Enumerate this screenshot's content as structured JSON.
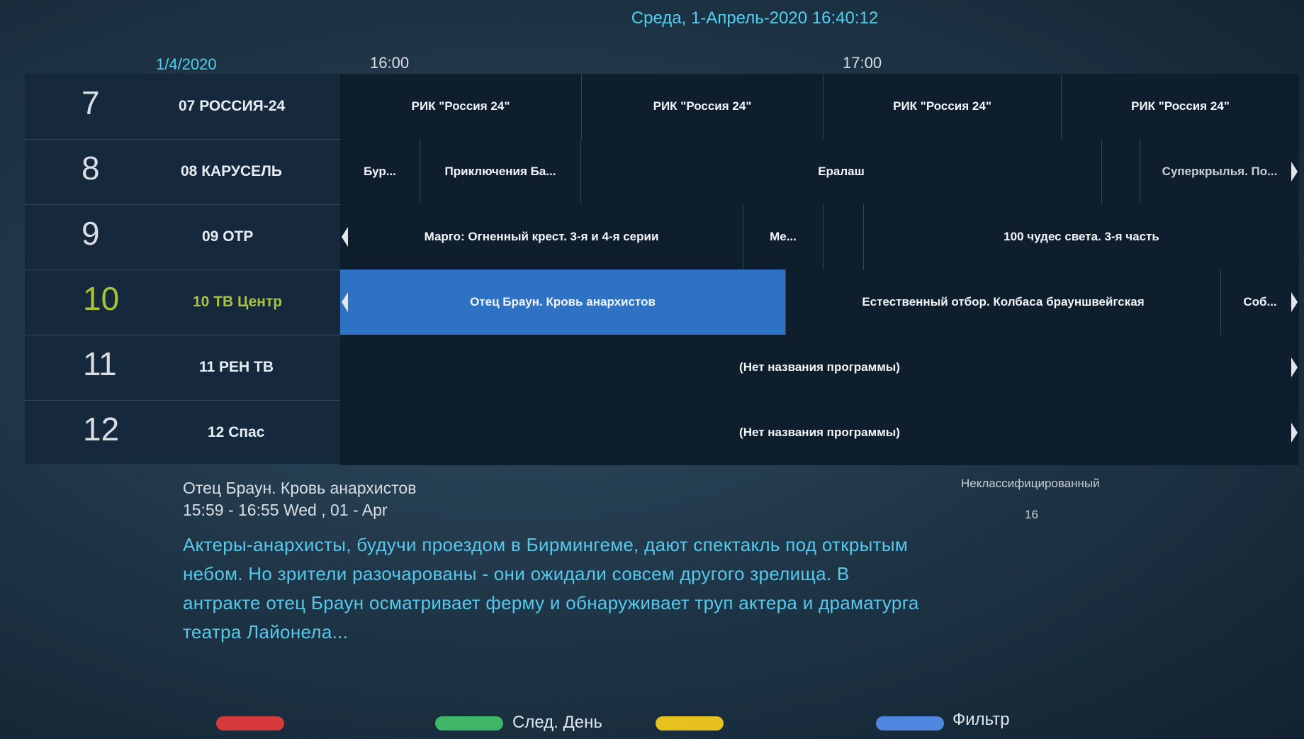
{
  "header": {
    "datetime": "Среда,  1-Апрель-2020 16:40:12"
  },
  "timeline": {
    "date": "1/4/2020",
    "ticks": [
      "16:00",
      "17:00"
    ]
  },
  "channels": [
    {
      "number": "7",
      "name": "07 РОССИЯ-24",
      "programs": [
        "РИК \"Россия 24\"",
        "РИК \"Россия 24\"",
        "РИК \"Россия 24\"",
        "РИК \"Россия 24\""
      ]
    },
    {
      "number": "8",
      "name": "08 КАРУСЕЛЬ",
      "programs": [
        "Бур...",
        "Приключения Ба...",
        "Ералаш",
        "",
        "Суперкрылья. По..."
      ]
    },
    {
      "number": "9",
      "name": "09 ОТР",
      "programs": [
        "Марго: Огненный крест. 3-я и 4-я серии",
        "Ме...",
        "",
        "100 чудес света. 3-я часть"
      ]
    },
    {
      "number": "10",
      "name": "10 ТВ Центр",
      "programs": [
        "Отец Браун. Кровь анархистов",
        "Естественный отбор. Колбаса брауншвейгская",
        "Соб..."
      ]
    },
    {
      "number": "11",
      "name": "11 РЕН ТВ",
      "programs": [
        "(Нет названия программы)"
      ]
    },
    {
      "number": "12",
      "name": "12 Спас",
      "programs": [
        "(Нет названия программы)"
      ]
    }
  ],
  "info": {
    "title": "Отец Браун. Кровь анархистов",
    "time": "15:59 - 16:55   Wed , 01 - Apr",
    "description": "Актеры-анархисты, будучи проездом в Бирмингеме, дают спектакль под открытым небом. Но зрители разочарованы - они ожидали совсем другого зрелища. В антракте отец Браун осматривает ферму и обнаруживает труп актера и драматурга театра Лайонела...",
    "category": "Неклассифицированный",
    "age": "16"
  },
  "footer": {
    "green_label": "След. День",
    "blue_label": "Фильтр",
    "colors": {
      "red": "#d63a3a",
      "green": "#3fb768",
      "yellow": "#e6c21e",
      "blue": "#4f86e0"
    }
  }
}
